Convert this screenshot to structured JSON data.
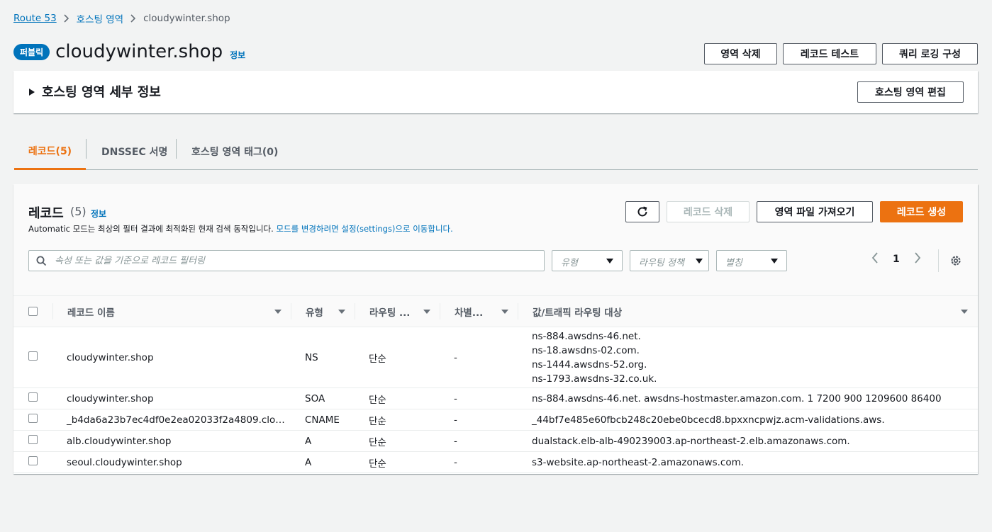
{
  "breadcrumb": {
    "root": "Route 53",
    "zones": "호스팅 영역",
    "current": "cloudywinter.shop"
  },
  "header": {
    "badge": "퍼블릭",
    "title": "cloudywinter.shop",
    "info": "정보"
  },
  "actions": {
    "delete_zone": "영역 삭제",
    "test_record": "레코드 테스트",
    "query_logging": "쿼리 로깅 구성"
  },
  "details": {
    "heading": "호스팅 영역 세부 정보",
    "edit": "호스팅 영역 편집"
  },
  "tabs": [
    {
      "label": "레코드(5)"
    },
    {
      "label": "DNSSEC 서명"
    },
    {
      "label": "호스팅 영역 태그(0)"
    }
  ],
  "records": {
    "title": "레코드",
    "count": "(5)",
    "info": "정보",
    "desc_text": "Automatic 모드는 최상의 필터 결과에 최적화된 현재 검색 동작입니다.",
    "desc_link": "모드를 변경하려면 설정(settings)으로 이동합니다.",
    "delete": "레코드 삭제",
    "import": "영역 파일 가져오기",
    "create": "레코드 생성",
    "search_placeholder": "속성 또는 값을 기준으로 레코드 필터링",
    "filter_type": "유형",
    "filter_routing": "라우팅 정책",
    "filter_alias": "별칭",
    "page": "1"
  },
  "table": {
    "columns": [
      "레코드 이름",
      "유형",
      "라우팅 ...",
      "차별...",
      "값/트래픽 라우팅 대상"
    ],
    "rows": [
      {
        "name": "cloudywinter.shop",
        "type": "NS",
        "routing": "단순",
        "diff": "-",
        "values": [
          "ns-884.awsdns-46.net.",
          "ns-18.awsdns-02.com.",
          "ns-1444.awsdns-52.org.",
          "ns-1793.awsdns-32.co.uk."
        ]
      },
      {
        "name": "cloudywinter.shop",
        "type": "SOA",
        "routing": "단순",
        "diff": "-",
        "values": [
          "ns-884.awsdns-46.net. awsdns-hostmaster.amazon.com. 1 7200 900 1209600 86400"
        ]
      },
      {
        "name": "_b4da6a23b7ec4df0e2ea02033f2a4809.clo…",
        "type": "CNAME",
        "routing": "단순",
        "diff": "-",
        "values": [
          "_44bf7e485e60fbcb248c20ebe0bcecd8.bpxxncpwjz.acm-validations.aws."
        ]
      },
      {
        "name": "alb.cloudywinter.shop",
        "type": "A",
        "routing": "단순",
        "diff": "-",
        "values": [
          "dualstack.elb-alb-490239003.ap-northeast-2.elb.amazonaws.com."
        ]
      },
      {
        "name": "seoul.cloudywinter.shop",
        "type": "A",
        "routing": "단순",
        "diff": "-",
        "values": [
          "s3-website.ap-northeast-2.amazonaws.com."
        ]
      }
    ]
  }
}
